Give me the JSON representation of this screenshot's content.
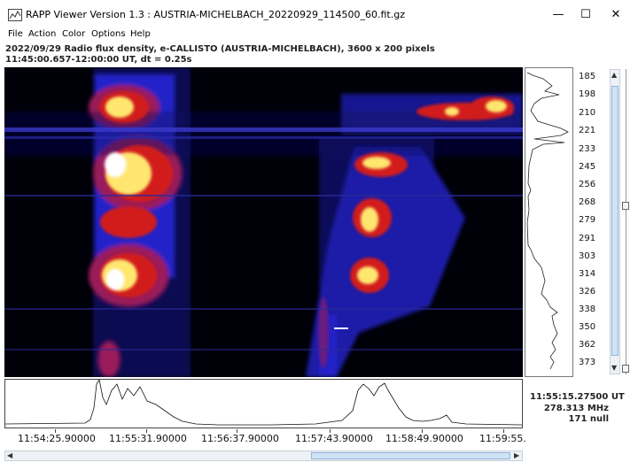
{
  "window": {
    "title": "RAPP Viewer Version 1.3 : AUSTRIA-MICHELBACH_20220929_114500_60.fit.gz",
    "minimize": "—",
    "maximize": "☐",
    "close": "✕"
  },
  "menu": [
    "File",
    "Action",
    "Color",
    "Options",
    "Help"
  ],
  "info": {
    "line1": "2022/09/29  Radio flux density, e-CALLISTO (AUSTRIA-MICHELBACH),  3600 x 200 pixels",
    "line2": "11:45:00.657-12:00:00 UT, dt = 0.25s"
  },
  "freq_labels": [
    "185",
    "198",
    "210",
    "221",
    "233",
    "245",
    "256",
    "268",
    "279",
    "291",
    "303",
    "314",
    "326",
    "338",
    "350",
    "362",
    "373"
  ],
  "cursor": {
    "time": "11:55:15.27500 UT",
    "freq": "278.313 MHz",
    "value": "171 null"
  },
  "time_labels": [
    "11:54:25.90000",
    "11:55:31.90000",
    "11:56:37.90000",
    "11:57:43.90000",
    "11:58:49.90000",
    "11:59:55."
  ],
  "colors": {
    "background": "#000008",
    "blue": "#1a1ab4",
    "red": "#d21e1e",
    "yellow": "#ffe66e",
    "white": "#ffffff"
  }
}
